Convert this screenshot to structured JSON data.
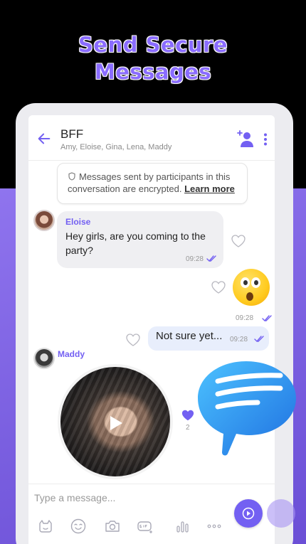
{
  "headline": {
    "line1": "Send Secure",
    "line2": "Messages"
  },
  "chat": {
    "title": "BFF",
    "participants": "Amy, Eloise, Gina, Lena, Maddy"
  },
  "encryption": {
    "text": "Messages sent by participants in this conversation are encrypted.",
    "link": "Learn more"
  },
  "messages": [
    {
      "sender": "Eloise",
      "text": "Hey girls, are you coming to the party?",
      "time": "09:28",
      "direction": "incoming"
    },
    {
      "type": "emoji-sticker",
      "icon": "shocked-face-icon",
      "time": "09:28",
      "direction": "outgoing"
    },
    {
      "text": "Not sure yet...",
      "time": "09:28",
      "direction": "outgoing"
    },
    {
      "sender": "Maddy",
      "type": "video-message",
      "likes": "2",
      "direction": "incoming"
    }
  ],
  "composer": {
    "placeholder": "Type a message...",
    "tools": [
      "sticker-icon",
      "emoji-icon",
      "camera-icon",
      "gif-icon",
      "chart-icon",
      "more-icon"
    ]
  },
  "colors": {
    "accent": "#7360f2",
    "background_gradient": "#7a5fe0",
    "outgoing_bubble": "#e8eefc",
    "incoming_bubble": "#efeff2"
  }
}
